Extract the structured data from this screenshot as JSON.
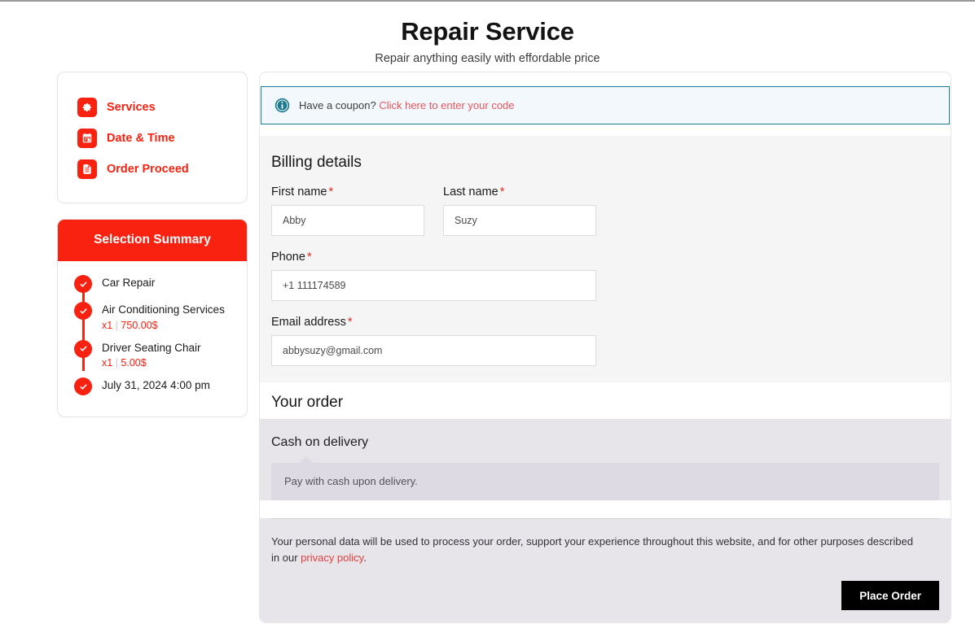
{
  "header": {
    "title": "Repair Service",
    "subtitle": "Repair anything easily with effordable price"
  },
  "sidebar": {
    "nav": [
      {
        "label": "Services",
        "icon": "gear-icon"
      },
      {
        "label": "Date & Time",
        "icon": "calendar-clock-icon"
      },
      {
        "label": "Order Proceed",
        "icon": "document-icon"
      }
    ],
    "summary": {
      "title": "Selection Summary",
      "items": [
        {
          "title": "Car Repair",
          "qty": "",
          "price": ""
        },
        {
          "title": "Air Conditioning Services",
          "qty": "x1",
          "sep": "|",
          "price": "750.00$"
        },
        {
          "title": "Driver Seating Chair",
          "qty": "x1",
          "sep": "|",
          "price": "5.00$"
        },
        {
          "title": "July 31, 2024 4:00 pm",
          "qty": "",
          "price": ""
        }
      ]
    }
  },
  "main": {
    "coupon": {
      "icon": "info-icon",
      "text": "Have a coupon?",
      "link": "Click here to enter your code"
    },
    "billing": {
      "heading": "Billing details",
      "required_mark": "*",
      "fields": {
        "first_name": {
          "label": "First name",
          "value": "Abby",
          "placeholder": "First name"
        },
        "last_name": {
          "label": "Last name",
          "value": "Suzy",
          "placeholder": "Last name"
        },
        "phone": {
          "label": "Phone",
          "value": "+1 111174589",
          "placeholder": "Phone"
        },
        "email": {
          "label": "Email address",
          "value": "abbysuzy@gmail.com",
          "placeholder": "Email address"
        }
      }
    },
    "order": {
      "heading": "Your order",
      "payment_method": "Cash on delivery",
      "payment_description": "Pay with cash upon delivery.",
      "privacy_text": "Your personal data will be used to process your order, support your experience throughout this website, and for other purposes described in our ",
      "privacy_link": "privacy policy",
      "privacy_tail": ".",
      "place_order": "Place Order"
    }
  },
  "colors": {
    "brand_red": "#f92110",
    "link_red": "#e3403a",
    "info_teal": "#1a7b93",
    "button_black": "#000000",
    "billing_bg": "#f5f5f5",
    "order_bg": "#e7e4ea"
  }
}
